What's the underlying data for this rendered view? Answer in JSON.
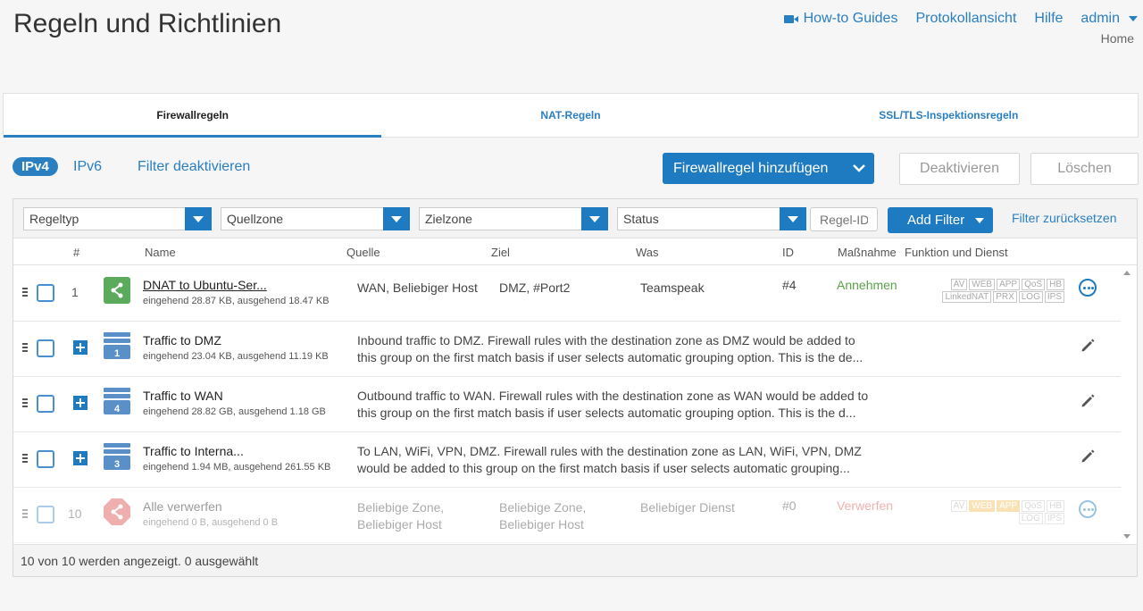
{
  "header": {
    "title": "Regeln und Richtlinien",
    "links": {
      "guides": "How-to Guides",
      "log": "Protokollansicht",
      "help": "Hilfe",
      "user": "admin"
    },
    "breadcrumb": "Home"
  },
  "tabs": [
    "Firewallregeln",
    "NAT-Regeln",
    "SSL/TLS-Inspektionsregeln"
  ],
  "toolbar": {
    "ipv4": "IPv4",
    "ipv6": "IPv6",
    "filter_off": "Filter deaktivieren",
    "add": "Firewallregel hinzufügen",
    "deactivate": "Deaktivieren",
    "delete": "Löschen"
  },
  "filters": {
    "type": "Regeltyp",
    "src": "Quellzone",
    "dst": "Zielzone",
    "status": "Status",
    "id_placeholder": "Regel-ID",
    "add_filter": "Add Filter",
    "reset": "Filter zurücksetzen"
  },
  "columns": [
    "#",
    "Name",
    "Quelle",
    "Ziel",
    "Was",
    "ID",
    "Maßnahme",
    "Funktion und Dienst"
  ],
  "rows": [
    {
      "num": "1",
      "name": "DNAT to Ubuntu-Ser...",
      "traffic": "eingehend 28.87 KB, ausgehend 18.47 KB",
      "src": "WAN, Beliebiger Host",
      "dst": "DMZ, #Port2",
      "what": "Teamspeak",
      "id": "#4",
      "action": "Annehmen"
    },
    {
      "group_num": "1",
      "name": "Traffic to DMZ",
      "traffic": "eingehend 23.04 KB, ausgehend 11.19 KB",
      "desc1": "Inbound traffic to DMZ. Firewall rules with the destination zone as DMZ would be added to",
      "desc2": "this group on the first match basis if user selects automatic grouping option. This is the de..."
    },
    {
      "group_num": "4",
      "name": "Traffic to WAN",
      "traffic": "eingehend 28.82 GB, ausgehend 1.18 GB",
      "desc1": "Outbound traffic to WAN. Firewall rules with the destination zone as WAN would be added to",
      "desc2": "this group on the first match basis if user selects automatic grouping option. This is the d..."
    },
    {
      "group_num": "3",
      "name": "Traffic to Interna...",
      "traffic": "eingehend 1.94 MB, ausgehend 261.55 KB",
      "desc1": "To LAN, WiFi, VPN, DMZ. Firewall rules with the destination zone as LAN, WiFi, VPN, DMZ",
      "desc2": "would be added to this group on the first match basis if user selects automatic grouping..."
    },
    {
      "num": "10",
      "name": "Alle verwerfen",
      "traffic": "eingehend 0 B, ausgehend 0 B",
      "src1": "Beliebige Zone,",
      "src2": "Beliebiger Host",
      "dst1": "Beliebige Zone,",
      "dst2": "Beliebiger Host",
      "what": "Beliebiger Dienst",
      "id": "#0",
      "action": "Verwerfen"
    }
  ],
  "chips": {
    "row1_a": [
      "AV",
      "WEB",
      "APP",
      "QoS",
      "HB"
    ],
    "row1_b": [
      "LinkedNAT",
      "PRX",
      "LOG",
      "IPS"
    ],
    "row5_a": [
      "AV",
      "WEB",
      "APP",
      "QoS",
      "HB"
    ],
    "row5_b": [
      "LOG",
      "IPS"
    ]
  },
  "footer": "10 von 10 werden angezeigt. 0 ausgewählt",
  "colors": {
    "accent": "#1f7bc1",
    "accept": "#5aa24a",
    "drop": "#e05050",
    "nat_icon": "#5cab5c",
    "group_icon": "#5b8fc7",
    "drop_icon": "#f5a0a0"
  }
}
